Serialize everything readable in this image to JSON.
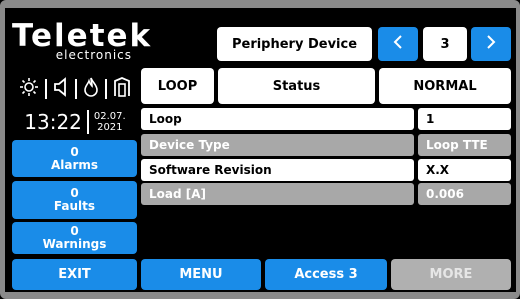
{
  "brand": {
    "name": "Teletek",
    "sub": "electronics"
  },
  "status_icons": [
    "sun-icon",
    "sound-icon",
    "flame-icon",
    "door-icon"
  ],
  "clock": {
    "time": "13:22",
    "date_line1": "02.07.",
    "date_line2": "2021"
  },
  "counters": {
    "alarms": {
      "count": "0",
      "label": "Alarms"
    },
    "faults": {
      "count": "0",
      "label": "Faults"
    },
    "warnings": {
      "count": "0",
      "label": "Warnings"
    }
  },
  "header": {
    "title": "Periphery Device",
    "prev_icon": "chevron-left-icon",
    "page": "3",
    "next_icon": "chevron-right-icon"
  },
  "sub_header": {
    "loop_tab": "LOOP",
    "status_label": "Status",
    "status_value": "NORMAL"
  },
  "rows": [
    {
      "label": "Loop",
      "value": "1"
    },
    {
      "label": "Device Type",
      "value": "Loop TTE"
    },
    {
      "label": "Software Revision",
      "value": "X.X"
    },
    {
      "label": "Load [A]",
      "value": "0.006"
    }
  ],
  "footer": {
    "exit": "EXIT",
    "menu": "MENU",
    "access": "Access 3",
    "more": "MORE"
  },
  "colors": {
    "blue": "#1a8ce8",
    "gray": "#a8a8a8",
    "frame": "#8a8a8a"
  }
}
